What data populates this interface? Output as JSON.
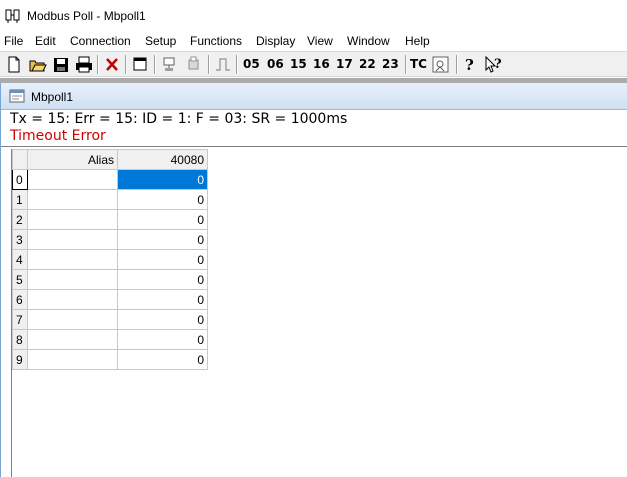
{
  "window": {
    "title": "Modbus Poll - Mbpoll1"
  },
  "menu": [
    "File",
    "Edit",
    "Connection",
    "Setup",
    "Functions",
    "Display",
    "View",
    "Window",
    "Help"
  ],
  "toolbar": {
    "icons": [
      "new-file-icon",
      "open-folder-icon",
      "save-icon",
      "print-icon",
      "delete-icon",
      "window-icon",
      "read-icon",
      "write-icon",
      "pulse-icon",
      "help-icon",
      "context-help-icon"
    ],
    "function_codes": [
      "05",
      "06",
      "15",
      "16",
      "17",
      "22",
      "23"
    ],
    "tc_label": "TC"
  },
  "child": {
    "title": "Mbpoll1",
    "status": "Tx = 15: Err = 15: ID = 1: F = 03: SR = 1000ms",
    "error": "Timeout Error"
  },
  "grid": {
    "alias_header": "Alias",
    "register_header": "40080",
    "selected_row": 0,
    "rows": [
      {
        "index": "0",
        "alias": "",
        "value": "0"
      },
      {
        "index": "1",
        "alias": "",
        "value": "0"
      },
      {
        "index": "2",
        "alias": "",
        "value": "0"
      },
      {
        "index": "3",
        "alias": "",
        "value": "0"
      },
      {
        "index": "4",
        "alias": "",
        "value": "0"
      },
      {
        "index": "5",
        "alias": "",
        "value": "0"
      },
      {
        "index": "6",
        "alias": "",
        "value": "0"
      },
      {
        "index": "7",
        "alias": "",
        "value": "0"
      },
      {
        "index": "8",
        "alias": "",
        "value": "0"
      },
      {
        "index": "9",
        "alias": "",
        "value": "0"
      }
    ]
  }
}
